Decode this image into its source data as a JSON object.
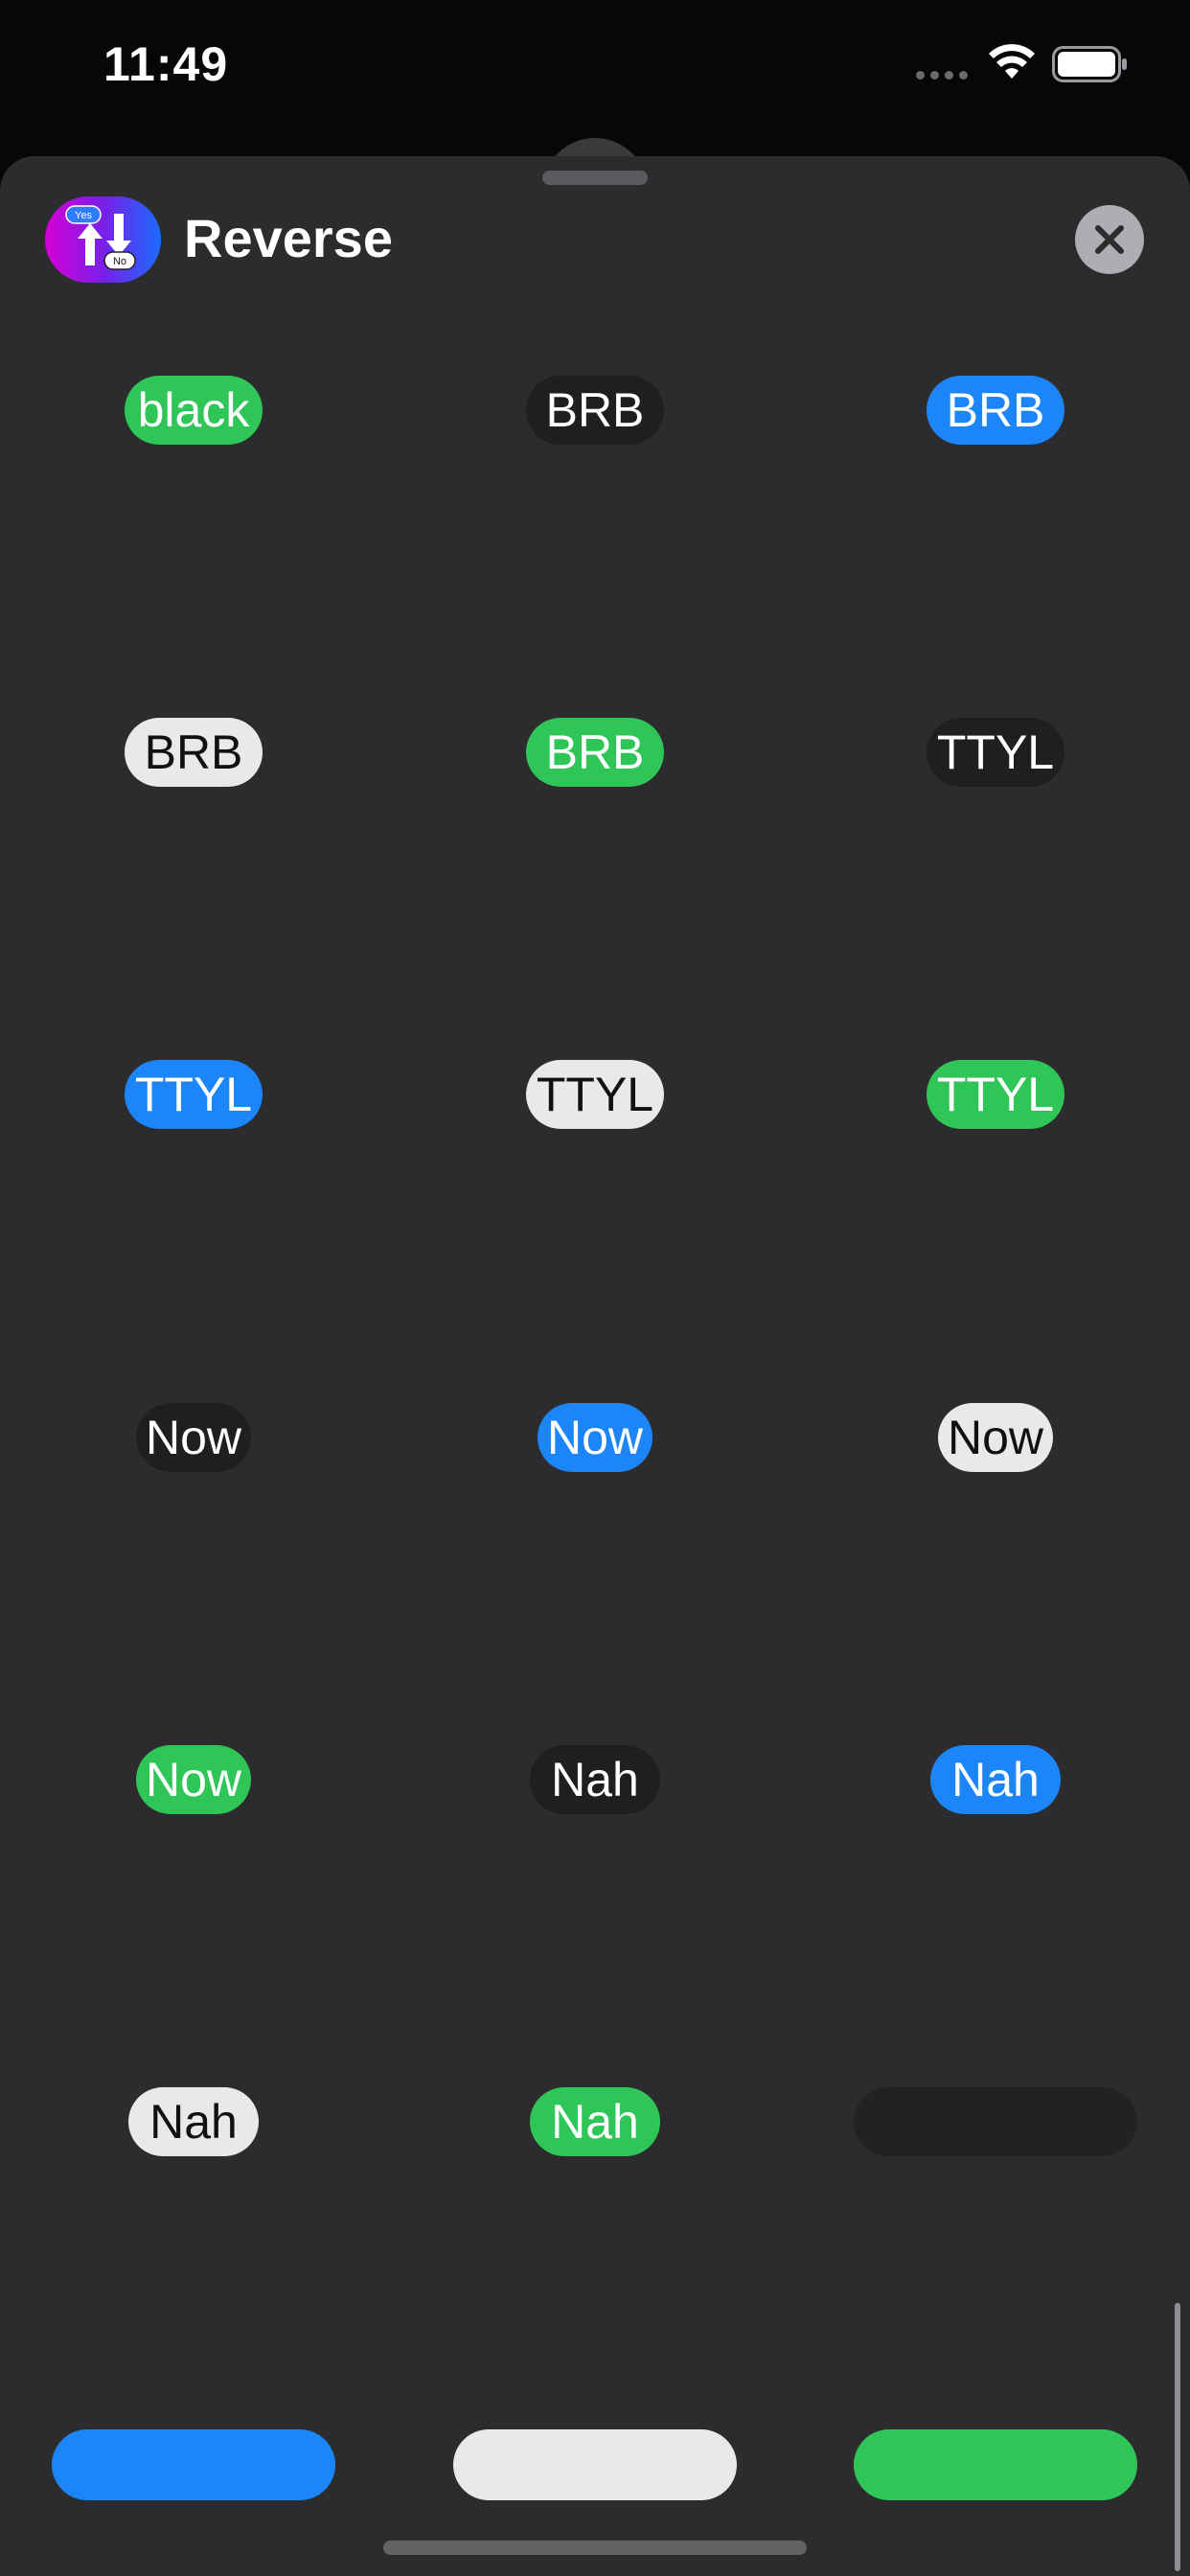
{
  "status_bar": {
    "time": "11:49",
    "icons": [
      "cellular-signal-icon",
      "wifi-icon",
      "battery-icon"
    ]
  },
  "header": {
    "title": "Reverse",
    "app_icon": {
      "name": "reverse-app-icon",
      "badge_yes": "Yes",
      "badge_no": "No"
    },
    "close_icon": "close-icon"
  },
  "colors": {
    "sheet_background": "#2c2c2e",
    "green": "#30c657",
    "black": "#1f1f21",
    "blue": "#1c86f8",
    "white": "#e9e9ec"
  },
  "stickers": [
    {
      "text": "black",
      "color": "green"
    },
    {
      "text": "BRB",
      "color": "black"
    },
    {
      "text": "BRB",
      "color": "blue"
    },
    {
      "text": "BRB",
      "color": "white"
    },
    {
      "text": "BRB",
      "color": "green"
    },
    {
      "text": "TTYL",
      "color": "black"
    },
    {
      "text": "TTYL",
      "color": "blue"
    },
    {
      "text": "TTYL",
      "color": "white"
    },
    {
      "text": "TTYL",
      "color": "green"
    },
    {
      "text": "Now",
      "color": "black"
    },
    {
      "text": "Now",
      "color": "blue"
    },
    {
      "text": "Now",
      "color": "white"
    },
    {
      "text": "Now",
      "color": "green"
    },
    {
      "text": "Nah",
      "color": "black"
    },
    {
      "text": "Nah",
      "color": "blue"
    },
    {
      "text": "Nah",
      "color": "white"
    },
    {
      "text": "Nah",
      "color": "green"
    },
    {
      "text": "",
      "color": "black"
    }
  ],
  "swatches": [
    {
      "color": "blue"
    },
    {
      "color": "white"
    },
    {
      "color": "green"
    }
  ]
}
